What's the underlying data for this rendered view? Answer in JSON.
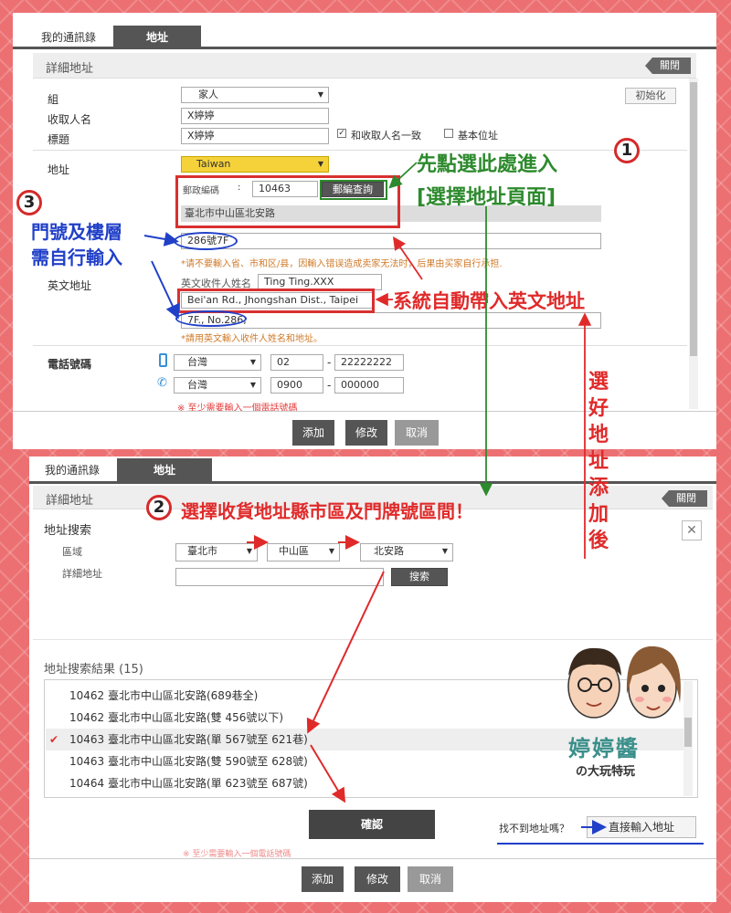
{
  "top": {
    "tabs": [
      "我的通訊錄",
      "地址"
    ],
    "header_title": "詳細地址",
    "close_label": "關閉",
    "reset_label": "初始化",
    "group_label": "組",
    "group_value": "家人",
    "recipient_label": "收取人名",
    "recipient_value": "X婷婷",
    "title_label": "標題",
    "title_value": "X婷婷",
    "same_as_recipient": "和收取人名一致",
    "basic_address": "基本位址",
    "address_label": "地址",
    "country_value": "Taiwan",
    "postal_label": "郵政編碼",
    "postal_colon": ":",
    "postal_value": "10463",
    "postal_btn": "郵編查詢",
    "district_value": "臺北市中山區北安路",
    "detail_value": "286號7F",
    "warning": "*请不要輸入省、市和区/县，因輸入错误造成卖家无法时，后果由买家自行承担.",
    "eng_name_label": "英文收件人姓名",
    "eng_name_value": "Ting Ting.XXX",
    "eng_addr_label": "英文地址",
    "eng_addr_value": "Bei'an Rd., Jhongshan Dist., Taipei City",
    "eng_detail_value": "7F., No.286,",
    "eng_note": "*請用英文輸入收件人姓名和地址。",
    "phone_label": "電話號碼",
    "phone1_country": "台灣",
    "phone1_area": "02",
    "phone1_dash": "-",
    "phone1_number": "22222222",
    "phone2_country": "台灣",
    "phone2_area": "0900",
    "phone2_dash": "-",
    "phone2_number": "000000",
    "phone_note": "※ 至少需要輸入一個電話號碼",
    "add_btn": "添加",
    "edit_btn": "修改",
    "cancel_btn": "取消"
  },
  "bottom": {
    "tabs": [
      "我的通訊錄",
      "地址"
    ],
    "header_title": "詳細地址",
    "close_label": "關閉",
    "search_title": "地址搜索",
    "region_label": "區域",
    "city_value": "臺北市",
    "district_value": "中山區",
    "road_value": "北安路",
    "detail_label": "詳細地址",
    "search_btn": "搜索",
    "results_title": "地址搜索結果 (15)",
    "results": [
      "10462 臺北市中山區北安路(689巷全)",
      "10462 臺北市中山區北安路(雙 456號以下)",
      "10463 臺北市中山區北安路(單 567號至 621巷)",
      "10463 臺北市中山區北安路(雙 590號至 628號)",
      "10464 臺北市中山區北安路(單 623號至 687號)"
    ],
    "selected_index": 2,
    "check_mark": "✔",
    "confirm_btn": "確認",
    "not_found": "找不到地址嗎？",
    "direct_input": "直接輸入地址",
    "hidden_note": "※ 至少需要輸入一個電話號碼",
    "add_btn": "添加",
    "edit_btn": "修改",
    "cancel_btn": "取消"
  },
  "annotations": {
    "step1_num": "1",
    "step1_text_line1": "先點選此處進入",
    "step1_text_line2": "[選擇地址頁面]",
    "step2_num": "2",
    "step2_text": "選擇收貨地址縣市區及門牌號區間！",
    "step3_num": "3",
    "step3_text_line1": "門號及樓層",
    "step3_text_line2": "需自行輸入",
    "auto_text": "系統自動帶入英文地址",
    "vertical_text": [
      "選",
      "好",
      "地",
      "址",
      "添",
      "加",
      "後"
    ],
    "logo_text_line1": "婷婷醬",
    "logo_text_line2": "の大玩特玩"
  },
  "colors": {
    "background": "#ec7072",
    "annotation_red": "#e02a2a",
    "annotation_green": "#2d8a2d",
    "annotation_blue": "#2140c8",
    "tab_active": "#555555"
  }
}
